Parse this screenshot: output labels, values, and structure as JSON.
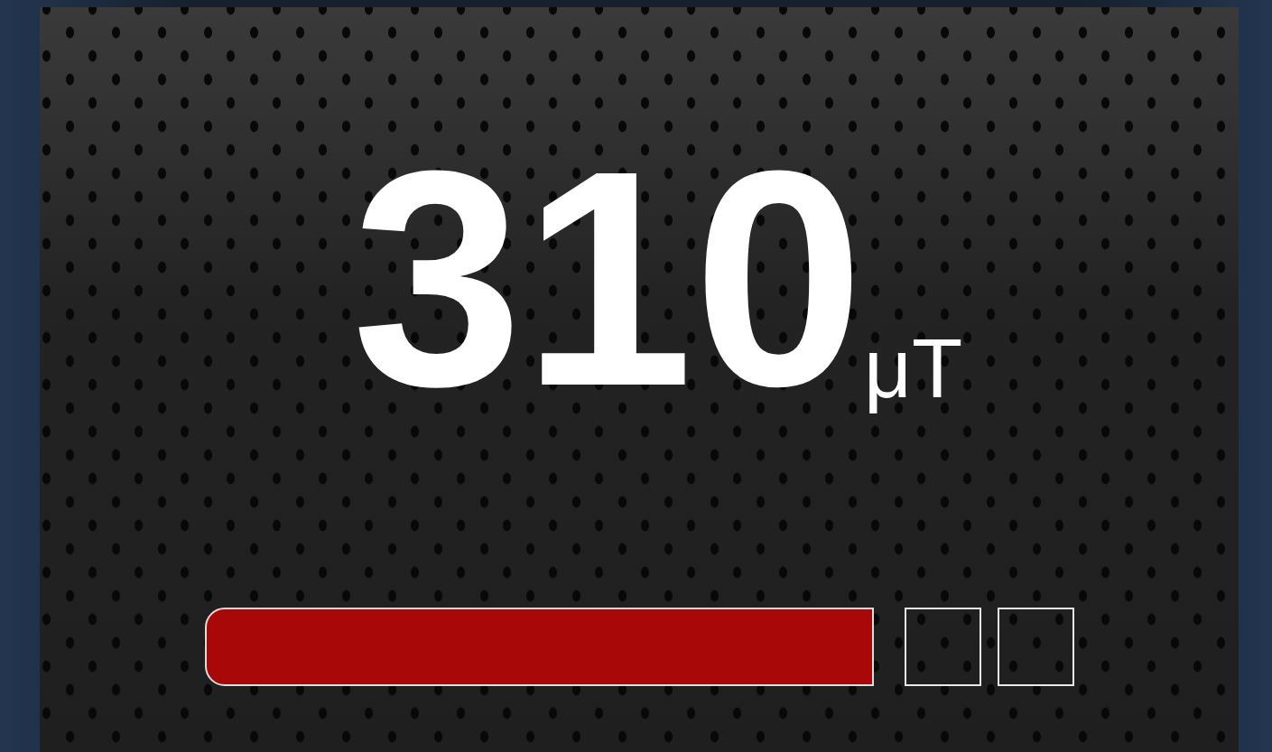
{
  "reading": {
    "value": "310",
    "unit": "μT"
  }
}
